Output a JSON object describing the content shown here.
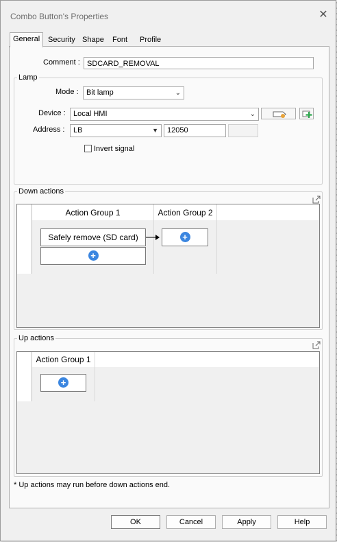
{
  "window": {
    "title": "Combo Button's Properties"
  },
  "tabs": [
    {
      "label": "General",
      "active": true
    },
    {
      "label": "Security",
      "active": false
    },
    {
      "label": "Shape",
      "active": false
    },
    {
      "label": "Font",
      "active": false
    },
    {
      "label": "Profile",
      "active": false
    }
  ],
  "general": {
    "comment_label": "Comment :",
    "comment_value": "SDCARD_REMOVAL",
    "lamp": {
      "group_label": "Lamp",
      "mode_label": "Mode :",
      "mode_value": "Bit lamp",
      "device_label": "Device :",
      "device_value": "Local HMI",
      "address_label": "Address :",
      "address_type": "LB",
      "address_value": "12050",
      "address_extra": "",
      "invert_label": "Invert signal",
      "invert_checked": false
    },
    "down_actions": {
      "group_label": "Down actions",
      "groups": [
        {
          "title": "Action Group 1",
          "actions": [
            "Safely remove (SD card)"
          ]
        },
        {
          "title": "Action Group 2",
          "actions": []
        }
      ]
    },
    "up_actions": {
      "group_label": "Up actions",
      "groups": [
        {
          "title": "Action Group 1",
          "actions": []
        }
      ]
    },
    "note": "* Up actions may run before down actions end."
  },
  "buttons": {
    "ok": "OK",
    "cancel": "Cancel",
    "apply": "Apply",
    "help": "Help"
  },
  "colors": {
    "accent": "#3b86e0",
    "window_bg": "#f0f0f0",
    "panel_bg": "#fafafa",
    "tag_orange": "#e8a33a",
    "add_green": "#2fa84f"
  }
}
